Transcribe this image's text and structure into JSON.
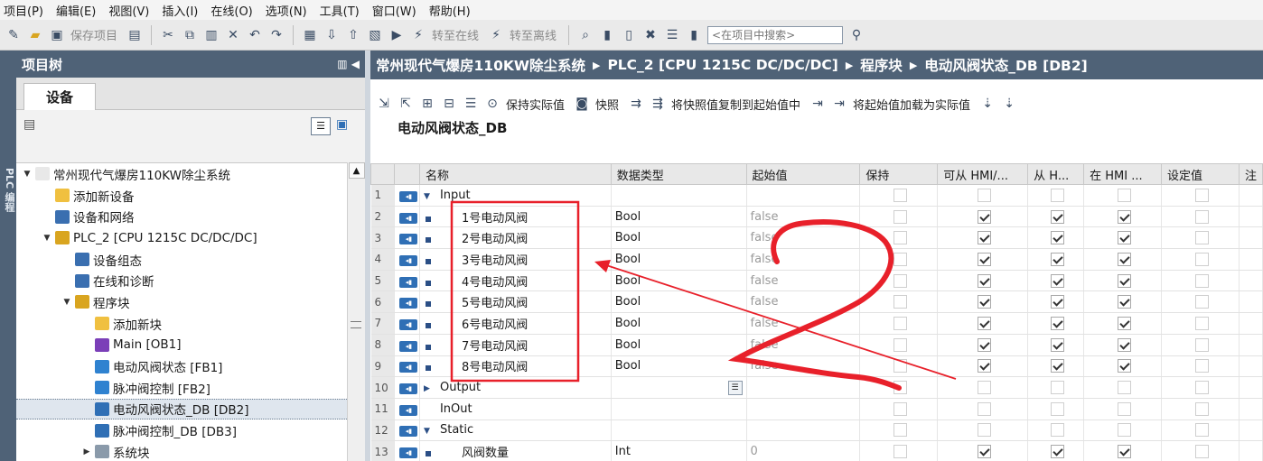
{
  "menu": [
    "项目(P)",
    "编辑(E)",
    "视图(V)",
    "插入(I)",
    "在线(O)",
    "选项(N)",
    "工具(T)",
    "窗口(W)",
    "帮助(H)"
  ],
  "toolbar": {
    "save_label": "保存项目",
    "go_online": "转至在线",
    "go_offline": "转至离线",
    "search_placeholder": "<在项目中搜索>"
  },
  "side_strip": "PLC 编程",
  "project_tree": {
    "title": "项目树",
    "tab": "设备",
    "items": [
      {
        "label": "常州现代气爆房110KW除尘系统",
        "level": 0,
        "expander": "▼"
      },
      {
        "label": "添加新设备",
        "level": 1,
        "expander": ""
      },
      {
        "label": "设备和网络",
        "level": 1,
        "expander": ""
      },
      {
        "label": "PLC_2 [CPU 1215C DC/DC/DC]",
        "level": 1,
        "expander": "▼"
      },
      {
        "label": "设备组态",
        "level": 2,
        "expander": ""
      },
      {
        "label": "在线和诊断",
        "level": 2,
        "expander": ""
      },
      {
        "label": "程序块",
        "level": 2,
        "expander": "▼"
      },
      {
        "label": "添加新块",
        "level": 3,
        "expander": ""
      },
      {
        "label": "Main [OB1]",
        "level": 3,
        "expander": ""
      },
      {
        "label": "电动风阀状态 [FB1]",
        "level": 3,
        "expander": ""
      },
      {
        "label": "脉冲阀控制 [FB2]",
        "level": 3,
        "expander": ""
      },
      {
        "label": "电动风阀状态_DB [DB2]",
        "level": 3,
        "expander": "",
        "selected": true
      },
      {
        "label": "脉冲阀控制_DB [DB3]",
        "level": 3,
        "expander": ""
      },
      {
        "label": "系统块",
        "level": 3,
        "expander": "▶"
      }
    ]
  },
  "breadcrumb": [
    "常州现代气爆房110KW除尘系统",
    "PLC_2 [CPU 1215C DC/DC/DC]",
    "程序块",
    "电动风阀状态_DB [DB2]"
  ],
  "editor_toolbar": {
    "keep_actual": "保持实际值",
    "snapshot": "快照",
    "copy_snapshot": "将快照值复制到起始值中",
    "load_start": "将起始值加载为实际值"
  },
  "db_title": "电动风阀状态_DB",
  "columns": [
    "名称",
    "数据类型",
    "起始值",
    "保持",
    "可从 HMI/...",
    "从 H...",
    "在 HMI ...",
    "设定值",
    "注"
  ],
  "rows": [
    {
      "n": "1",
      "name": "Input",
      "type": "",
      "start": "",
      "section": true,
      "exp": "▼",
      "ret": false,
      "c1": false,
      "c2": false,
      "c3": false
    },
    {
      "n": "2",
      "name": "1号电动风阀",
      "type": "Bool",
      "start": "false",
      "section": false,
      "ret": false,
      "c1": true,
      "c2": true,
      "c3": true
    },
    {
      "n": "3",
      "name": "2号电动风阀",
      "type": "Bool",
      "start": "false",
      "section": false,
      "ret": false,
      "c1": true,
      "c2": true,
      "c3": true
    },
    {
      "n": "4",
      "name": "3号电动风阀",
      "type": "Bool",
      "start": "false",
      "section": false,
      "ret": false,
      "c1": true,
      "c2": true,
      "c3": true
    },
    {
      "n": "5",
      "name": "4号电动风阀",
      "type": "Bool",
      "start": "false",
      "section": false,
      "ret": false,
      "c1": true,
      "c2": true,
      "c3": true
    },
    {
      "n": "6",
      "name": "5号电动风阀",
      "type": "Bool",
      "start": "false",
      "section": false,
      "ret": false,
      "c1": true,
      "c2": true,
      "c3": true
    },
    {
      "n": "7",
      "name": "6号电动风阀",
      "type": "Bool",
      "start": "false",
      "section": false,
      "ret": false,
      "c1": true,
      "c2": true,
      "c3": true
    },
    {
      "n": "8",
      "name": "7号电动风阀",
      "type": "Bool",
      "start": "false",
      "section": false,
      "ret": false,
      "c1": true,
      "c2": true,
      "c3": true
    },
    {
      "n": "9",
      "name": "8号电动风阀",
      "type": "Bool",
      "start": "false",
      "section": false,
      "ret": false,
      "c1": true,
      "c2": true,
      "c3": true
    },
    {
      "n": "10",
      "name": "Output",
      "type": "",
      "start": "",
      "section": true,
      "exp": "▶",
      "ret": false,
      "c1": false,
      "c2": false,
      "c3": false
    },
    {
      "n": "11",
      "name": "InOut",
      "type": "",
      "start": "",
      "section": true,
      "exp": "",
      "ret": false,
      "c1": false,
      "c2": false,
      "c3": false
    },
    {
      "n": "12",
      "name": "Static",
      "type": "",
      "start": "",
      "section": true,
      "exp": "▼",
      "ret": false,
      "c1": false,
      "c2": false,
      "c3": false
    },
    {
      "n": "13",
      "name": "风阀数量",
      "type": "Int",
      "start": "0",
      "section": false,
      "ret": false,
      "c1": true,
      "c2": true,
      "c3": true
    }
  ],
  "annotation": {
    "number": "2",
    "ink_color": "#e8202a"
  }
}
